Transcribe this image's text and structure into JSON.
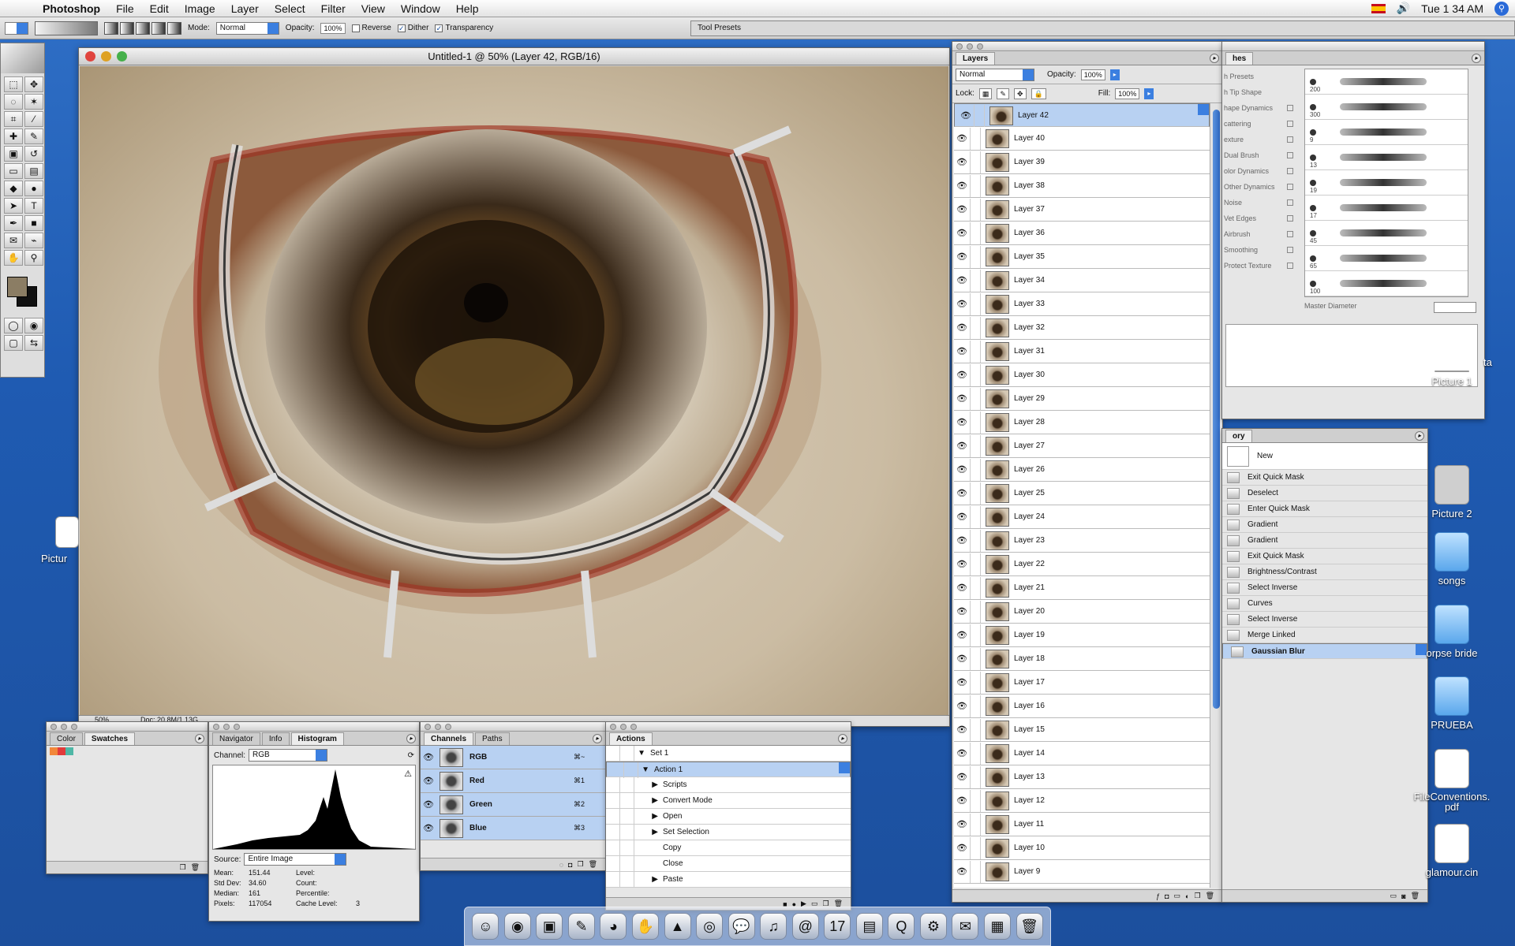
{
  "menubar": {
    "app": "Photoshop",
    "items": [
      "File",
      "Edit",
      "Image",
      "Layer",
      "Select",
      "Filter",
      "View",
      "Window",
      "Help"
    ],
    "clock": "Tue 1 34 AM"
  },
  "options": {
    "mode_label": "Mode:",
    "mode_value": "Normal",
    "opacity_label": "Opacity:",
    "opacity_value": "100%",
    "reverse": "Reverse",
    "dither": "Dither",
    "transparency": "Transparency",
    "tool_presets": "Tool Presets"
  },
  "document": {
    "title": "Untitled-1 @ 50% (Layer 42, RGB/16)",
    "zoom": "50%",
    "doc_info": "Doc: 20.8M/1.13G"
  },
  "layers": {
    "tab": "Layers",
    "blend": "Normal",
    "opacity_label": "Opacity:",
    "opacity": "100%",
    "lock_label": "Lock:",
    "fill_label": "Fill:",
    "fill": "100%",
    "items": [
      "Layer 42",
      "Layer 40",
      "Layer 39",
      "Layer 38",
      "Layer 37",
      "Layer 36",
      "Layer 35",
      "Layer 34",
      "Layer 33",
      "Layer 32",
      "Layer 31",
      "Layer 30",
      "Layer 29",
      "Layer 28",
      "Layer 27",
      "Layer 26",
      "Layer 25",
      "Layer 24",
      "Layer 23",
      "Layer 22",
      "Layer 21",
      "Layer 20",
      "Layer 19",
      "Layer 18",
      "Layer 17",
      "Layer 16",
      "Layer 15",
      "Layer 14",
      "Layer 13",
      "Layer 12",
      "Layer 11",
      "Layer 10",
      "Layer 9"
    ]
  },
  "brushes": {
    "tab": "hes",
    "options": [
      "h Presets",
      "h Tip Shape",
      "hape Dynamics",
      "cattering",
      "exture",
      "Dual Brush",
      "olor Dynamics",
      "Other Dynamics",
      "Noise",
      "Vet Edges",
      "Airbrush",
      "Smoothing",
      "Protect Texture"
    ],
    "thumbs": [
      "200",
      "300",
      "9",
      "13",
      "19",
      "17",
      "45",
      "65",
      "100"
    ],
    "master": "Master Diameter"
  },
  "history": {
    "tab": "ory",
    "new": "New",
    "items": [
      "Exit Quick Mask",
      "Deselect",
      "Enter Quick Mask",
      "Gradient",
      "Gradient",
      "Exit Quick Mask",
      "Brightness/Contrast",
      "Select Inverse",
      "Curves",
      "Select Inverse",
      "Merge Linked",
      "Gaussian Blur"
    ]
  },
  "color_panel": {
    "tabs": [
      "Color",
      "Swatches"
    ]
  },
  "histogram": {
    "tabs": [
      "Navigator",
      "Info",
      "Histogram"
    ],
    "channel_label": "Channel:",
    "channel": "RGB",
    "source_label": "Source:",
    "source": "Entire Image",
    "stats": {
      "mean_l": "Mean:",
      "mean": "151.44",
      "std_l": "Std Dev:",
      "std": "34.60",
      "median_l": "Median:",
      "median": "161",
      "pixels_l": "Pixels:",
      "pixels": "117054",
      "level_l": "Level:",
      "count_l": "Count:",
      "percentile_l": "Percentile:",
      "cache_l": "Cache Level:",
      "cache": "3"
    }
  },
  "channels": {
    "tabs": [
      "Channels",
      "Paths"
    ],
    "items": [
      {
        "name": "RGB",
        "key": "⌘~"
      },
      {
        "name": "Red",
        "key": "⌘1"
      },
      {
        "name": "Green",
        "key": "⌘2"
      },
      {
        "name": "Blue",
        "key": "⌘3"
      }
    ]
  },
  "actions": {
    "tab": "Actions",
    "items": [
      "Set 1",
      "Action 1",
      "Scripts",
      "Convert Mode",
      "Open",
      "Set Selection",
      "Copy",
      "Close",
      "Paste"
    ]
  },
  "desktop": {
    "icons": [
      "Picture 1",
      "Picture 2",
      "songs",
      "orpse bride",
      "PRUEBA",
      "FileConventions.\npdf",
      "glamour.cin",
      "Pictur",
      "ta"
    ]
  }
}
